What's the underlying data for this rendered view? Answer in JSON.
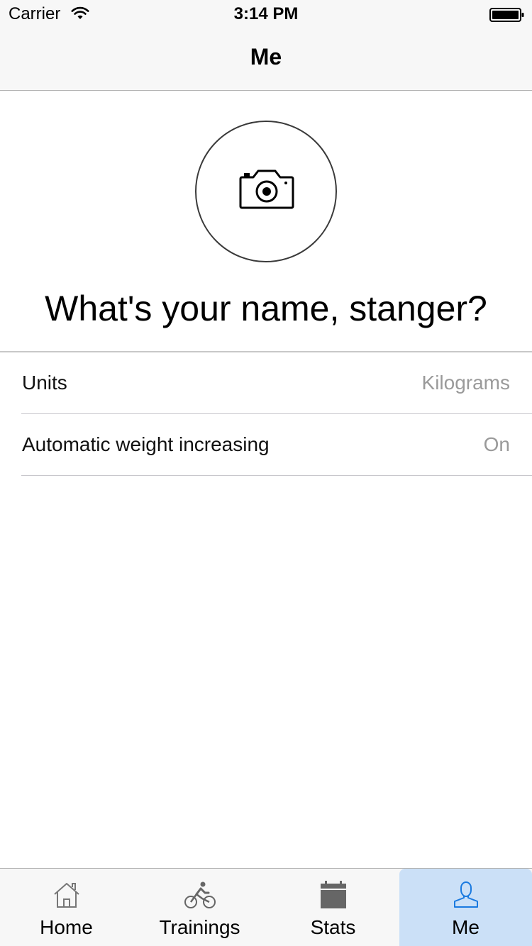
{
  "status_bar": {
    "carrier": "Carrier",
    "time": "3:14 PM"
  },
  "nav": {
    "title": "Me"
  },
  "profile": {
    "prompt": "What's your name, stanger?"
  },
  "settings": [
    {
      "label": "Units",
      "value": "Kilograms"
    },
    {
      "label": "Automatic weight increasing",
      "value": "On"
    }
  ],
  "tab_bar": {
    "active_index": 3,
    "active_color": "#1a7ae0",
    "tabs": [
      {
        "label": "Home",
        "icon": "home-icon"
      },
      {
        "label": "Trainings",
        "icon": "bicycle-icon"
      },
      {
        "label": "Stats",
        "icon": "calendar-icon"
      },
      {
        "label": "Me",
        "icon": "person-icon"
      }
    ]
  }
}
